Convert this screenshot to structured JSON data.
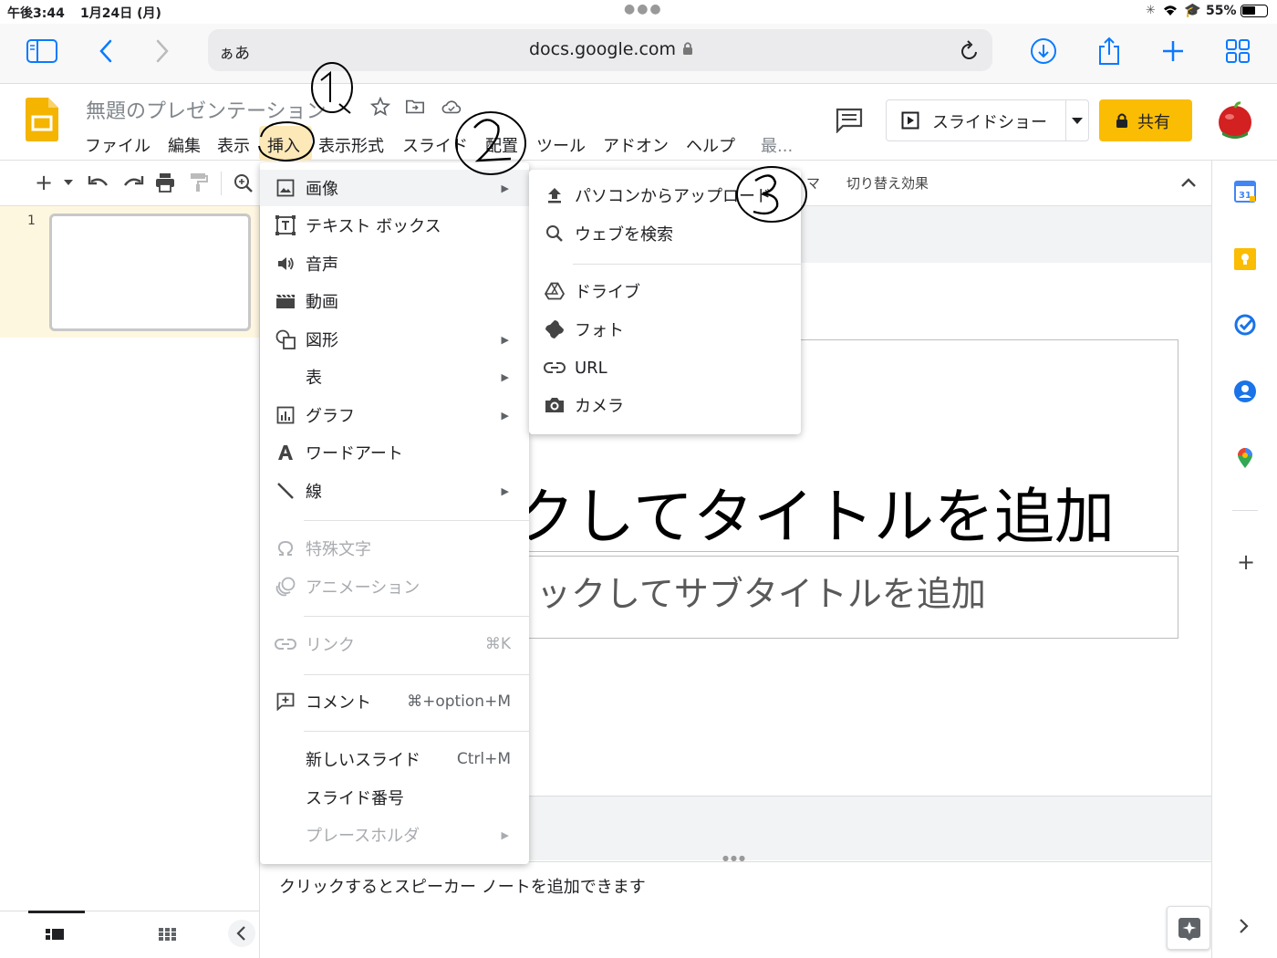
{
  "status": {
    "time": "午後3:44",
    "date": "1月24日 (月)",
    "battery": "55%"
  },
  "safari": {
    "text_size": "ぁあ",
    "url": "docs.google.com"
  },
  "doc": {
    "title": "無題のプレゼンテーション",
    "menus": [
      "ファイル",
      "編集",
      "表示",
      "挿入",
      "表示形式",
      "スライド",
      "配置",
      "ツール",
      "アドオン",
      "ヘルプ",
      "最..."
    ],
    "slideshow_label": "スライドショー",
    "share_label": "共有"
  },
  "toolbar": {
    "theme_partial": "マ",
    "transition": "切り替え効果"
  },
  "filmstrip": {
    "slide_number": "1"
  },
  "slide": {
    "title_placeholder": "クしてタイトルを追加",
    "subtitle_placeholder": "ックしてサブタイトルを追加"
  },
  "notes_placeholder": "クリックするとスピーカー ノートを追加できます",
  "insert_menu": {
    "items": [
      {
        "label": "画像",
        "icon": "image-icon",
        "submenu": true
      },
      {
        "label": "テキスト ボックス",
        "icon": "textbox-icon"
      },
      {
        "label": "音声",
        "icon": "audio-icon"
      },
      {
        "label": "動画",
        "icon": "video-icon"
      },
      {
        "label": "図形",
        "icon": "shape-icon",
        "submenu": true
      },
      {
        "label": "表",
        "submenu": true
      },
      {
        "label": "グラフ",
        "icon": "chart-icon",
        "submenu": true
      },
      {
        "label": "ワードアート",
        "icon": "wordart-icon"
      },
      {
        "label": "線",
        "icon": "line-icon",
        "submenu": true
      },
      {
        "label": "特殊文字",
        "icon": "omega-icon",
        "disabled": true
      },
      {
        "label": "アニメーション",
        "icon": "animation-icon",
        "disabled": true
      },
      {
        "label": "リンク",
        "icon": "link-icon",
        "shortcut": "⌘K",
        "disabled": true
      },
      {
        "label": "コメント",
        "icon": "add-comment-icon",
        "shortcut": "⌘+option+M"
      },
      {
        "label": "新しいスライド",
        "shortcut": "Ctrl+M"
      },
      {
        "label": "スライド番号"
      },
      {
        "label": "プレースホルダ",
        "submenu": true,
        "disabled": true
      }
    ]
  },
  "image_submenu": {
    "items": [
      {
        "label": "パソコンからアップロード",
        "icon": "upload-icon"
      },
      {
        "label": "ウェブを検索",
        "icon": "search-icon"
      },
      {
        "label": "ドライブ",
        "icon": "drive-icon"
      },
      {
        "label": "フォト",
        "icon": "photos-icon"
      },
      {
        "label": "URL",
        "icon": "link-icon"
      },
      {
        "label": "カメラ",
        "icon": "camera-icon"
      }
    ]
  },
  "annotations": [
    "①",
    "②",
    "③"
  ],
  "colors": {
    "accent_yellow": "#fbbc04",
    "slides_yellow": "#f4b400",
    "safari_blue": "#0a7aff"
  }
}
